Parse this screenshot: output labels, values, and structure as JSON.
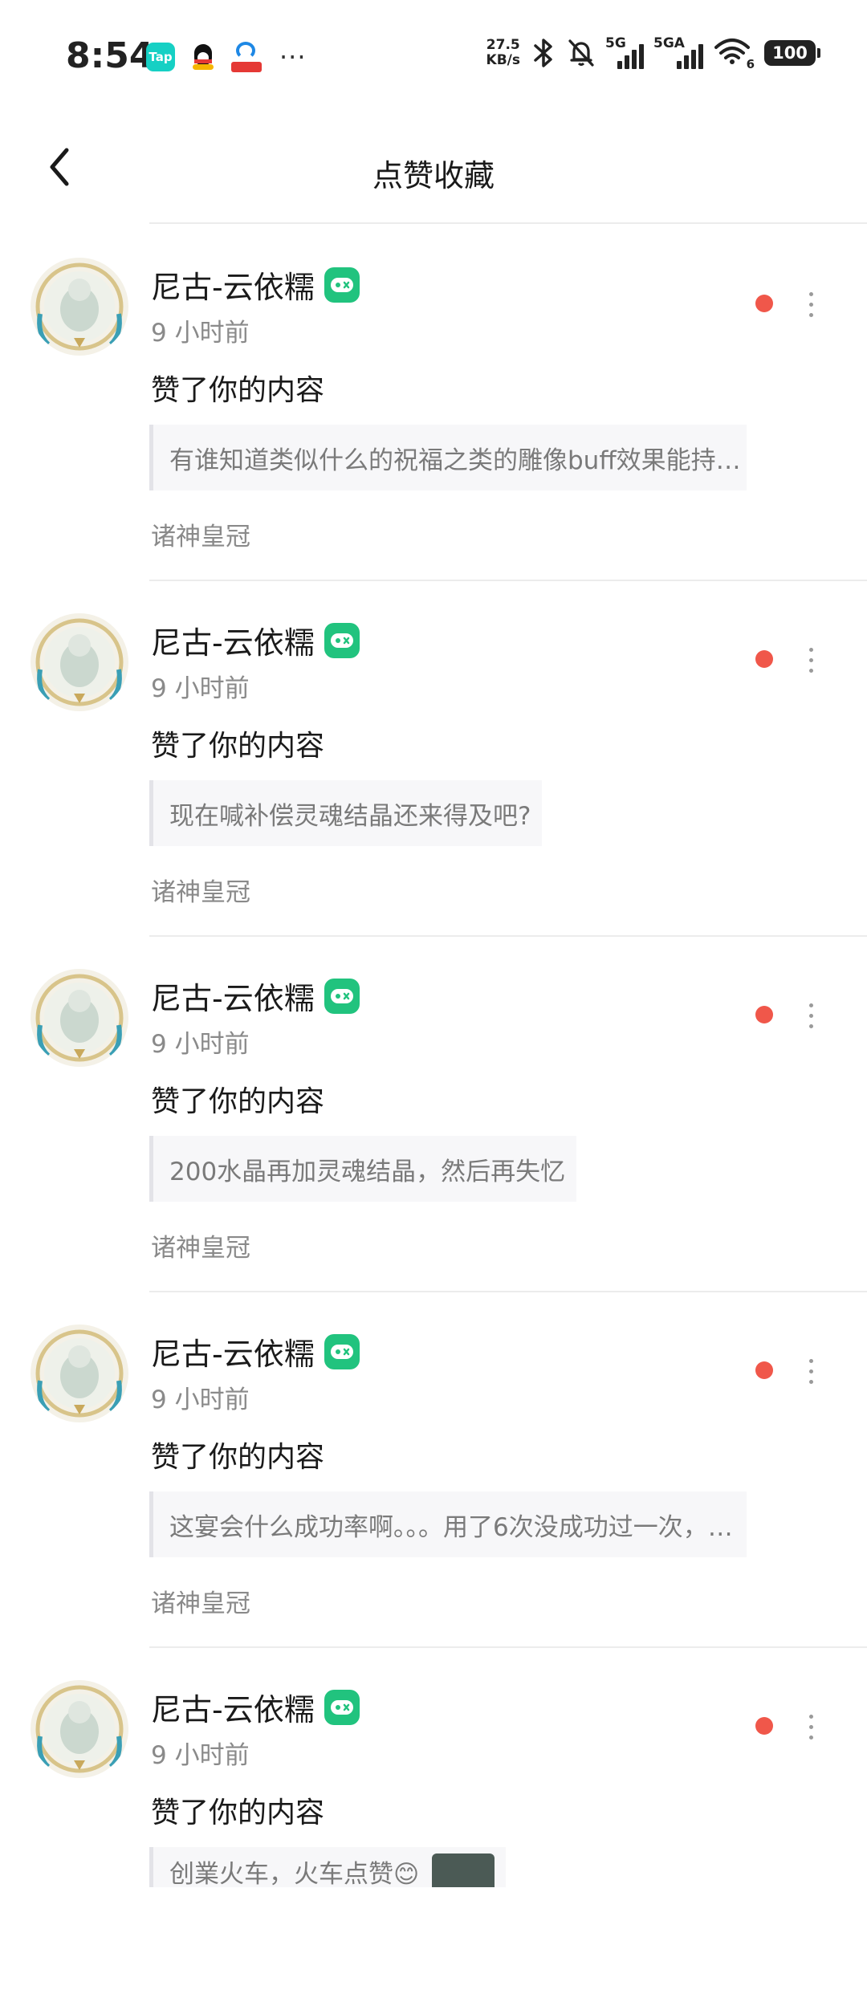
{
  "status_bar": {
    "time": "8:54",
    "left_icons": [
      "taptap-icon",
      "qq-icon",
      "china-telecom-icon",
      "more-notifications-icon"
    ],
    "taptap_label": "Tap",
    "more_dots": "···",
    "net_speed_value": "27.5",
    "net_speed_unit": "KB/s",
    "signal1_label": "5G",
    "signal2_label": "5GA",
    "wifi_label": "6",
    "battery": "100"
  },
  "header": {
    "title": "点赞收藏",
    "back_icon": "chevron-left-icon"
  },
  "colors": {
    "badge_green": "#21c37e",
    "unread_dot": "#f0574a",
    "muted_text": "#8a8a8a",
    "divider": "#ececec"
  },
  "items": [
    {
      "username": "尼古-云依糯",
      "time_ago": "9 小时前",
      "action": "赞了你的内容",
      "quote": "有谁知道类似什么的祝福之类的雕像buff效果能持…",
      "forum": "诸神皇冠",
      "unread": true
    },
    {
      "username": "尼古-云依糯",
      "time_ago": "9 小时前",
      "action": "赞了你的内容",
      "quote": "现在喊补偿灵魂结晶还来得及吧?",
      "forum": "诸神皇冠",
      "unread": true
    },
    {
      "username": "尼古-云依糯",
      "time_ago": "9 小时前",
      "action": "赞了你的内容",
      "quote": "200水晶再加灵魂结晶，然后再失忆",
      "forum": "诸神皇冠",
      "unread": true
    },
    {
      "username": "尼古-云依糯",
      "time_ago": "9 小时前",
      "action": "赞了你的内容",
      "quote": "这宴会什么成功率啊。。。用了6次没成功过一次，…",
      "forum": "诸神皇冠",
      "unread": true
    },
    {
      "username": "尼古-云依糯",
      "time_ago": "9 小时前",
      "action": "赞了你的内容",
      "quote": "创業火车，火车点赞😊",
      "forum": "",
      "unread": true
    }
  ]
}
